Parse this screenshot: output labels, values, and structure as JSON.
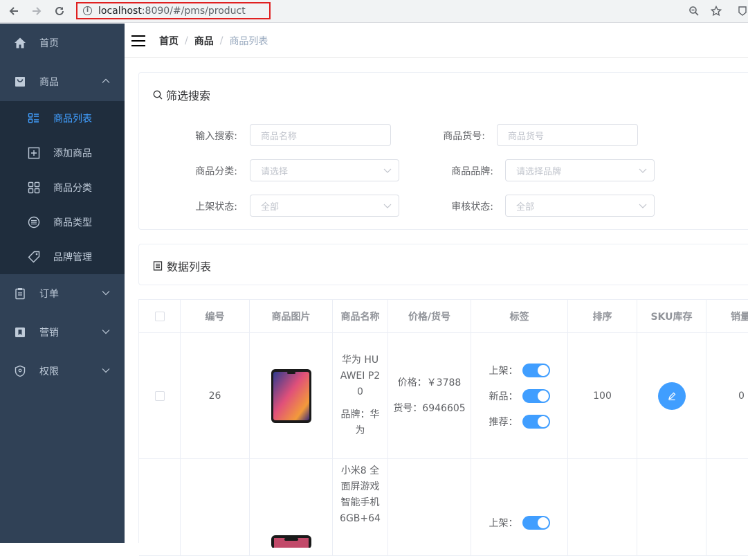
{
  "browser": {
    "url_host": "localhost",
    "url_rest": ":8090/#/pms/product"
  },
  "sidebar": {
    "items": [
      {
        "label": "首页",
        "icon": "home-icon"
      },
      {
        "label": "商品",
        "icon": "bag-icon",
        "expanded": true,
        "children": [
          {
            "label": "商品列表",
            "icon": "list-icon",
            "active": true
          },
          {
            "label": "添加商品",
            "icon": "plus-square-icon"
          },
          {
            "label": "商品分类",
            "icon": "grid-icon"
          },
          {
            "label": "商品类型",
            "icon": "lines-circle-icon"
          },
          {
            "label": "品牌管理",
            "icon": "tag-icon"
          }
        ]
      },
      {
        "label": "订单",
        "icon": "clipboard-icon"
      },
      {
        "label": "营销",
        "icon": "bookmark-icon"
      },
      {
        "label": "权限",
        "icon": "shield-icon"
      }
    ]
  },
  "breadcrumb": [
    "首页",
    "商品",
    "商品列表"
  ],
  "filter": {
    "title": "筛选搜索",
    "fields": [
      {
        "label": "输入搜索:",
        "placeholder": "商品名称"
      },
      {
        "label": "商品货号:",
        "placeholder": "商品货号"
      },
      {
        "label": "商品分类:",
        "placeholder": "请选择"
      },
      {
        "label": "商品品牌:",
        "placeholder": "请选择品牌"
      },
      {
        "label": "上架状态:",
        "placeholder": "全部"
      },
      {
        "label": "审核状态:",
        "placeholder": "全部"
      }
    ]
  },
  "datalist": {
    "title": "数据列表"
  },
  "table": {
    "headers": [
      "编号",
      "商品图片",
      "商品名称",
      "价格/货号",
      "标签",
      "排序",
      "SKU库存",
      "销量"
    ],
    "rows": [
      {
        "id": "26",
        "name_lines": [
          "华为 HU",
          "AWEI P2",
          "0"
        ],
        "brand_lines": [
          "品牌：华",
          "为"
        ],
        "price": "价格：￥3788",
        "sn": "货号：6946605",
        "tags": [
          "上架：",
          "新品：",
          "推荐："
        ],
        "sort": "100",
        "sales": "0"
      },
      {
        "name_lines": [
          "小米8 全",
          "面屏游戏",
          "智能手机",
          "6GB+64"
        ],
        "tags": [
          "上架："
        ]
      }
    ]
  },
  "colors": {
    "sidebar_bg": "#304156",
    "submenu_bg": "#1f2d3d",
    "accent": "#409eff"
  }
}
